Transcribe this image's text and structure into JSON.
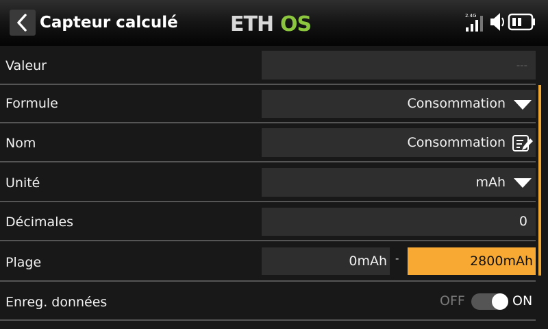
{
  "header": {
    "title": "Capteur calculé",
    "logo_text": "ETHOS",
    "signal_band": "2.4G",
    "back_icon": "chevron-left-icon",
    "volume_icon": "speaker-icon",
    "battery_icon": "battery-icon"
  },
  "rows": {
    "valeur": {
      "label": "Valeur",
      "value": "---"
    },
    "formule": {
      "label": "Formule",
      "value": "Consommation",
      "icon": "dropdown-arrow-icon"
    },
    "nom": {
      "label": "Nom",
      "value": "Consommation",
      "icon": "edit-icon"
    },
    "unite": {
      "label": "Unité",
      "value": "mAh",
      "icon": "dropdown-arrow-icon"
    },
    "decimales": {
      "label": "Décimales",
      "value": "0"
    },
    "plage": {
      "label": "Plage",
      "min": "0mAh",
      "separator": "-",
      "max": "2800mAh"
    },
    "enreg": {
      "label": "Enreg. données",
      "off_label": "OFF",
      "on_label": "ON",
      "state": "on"
    }
  },
  "colors": {
    "background": "#181818",
    "field": "#2e2e2e",
    "accent": "#f7a933",
    "logo_green": "#8cc63f",
    "logo_gray": "#d8d8d8"
  }
}
